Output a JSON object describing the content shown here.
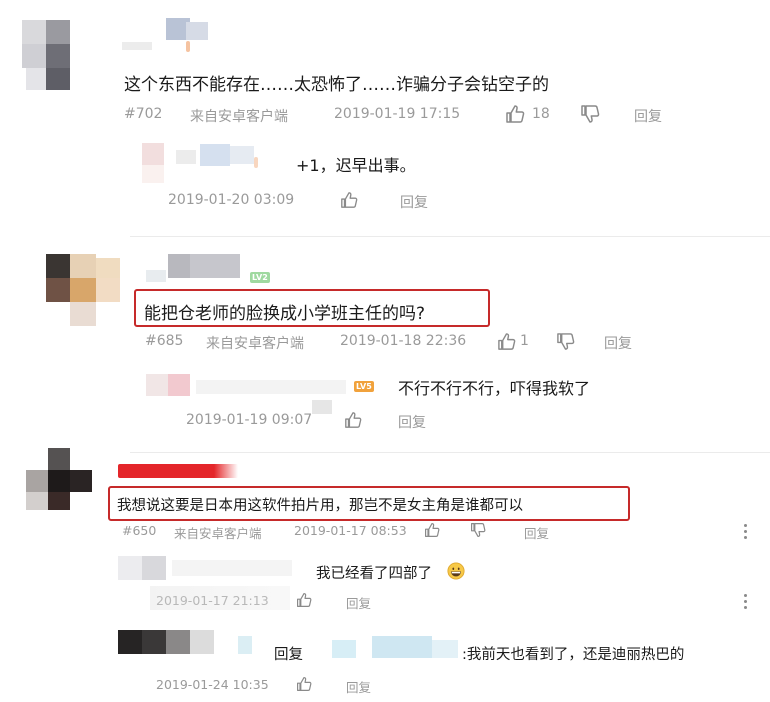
{
  "comments": [
    {
      "text": "这个东西不能存在……太恐怖了……诈骗分子会钻空子的",
      "floor": "#702",
      "source": "来自安卓客户端",
      "time": "2019-01-19 17:15",
      "likes": "18",
      "reply_label": "回复",
      "sub_replies": [
        {
          "text": "+1，迟早出事。",
          "time": "2019-01-20 03:09",
          "reply_label": "回复"
        }
      ]
    },
    {
      "level_badge": "LV2",
      "text": "能把仓老师的脸换成小学班主任的吗?",
      "floor": "#685",
      "source": "来自安卓客户端",
      "time": "2019-01-18 22:36",
      "likes": "1",
      "reply_label": "回复",
      "sub_replies": [
        {
          "level_badge": "LV5",
          "text": "不行不行不行，吓得我软了",
          "time": "2019-01-19 09:07",
          "reply_label": "回复"
        }
      ]
    },
    {
      "text": "我想说这要是日本用这软件拍片用，那岂不是女主角是谁都可以",
      "floor": "#650",
      "source": "来自安卓客户端",
      "time": "2019-01-17 08:53",
      "reply_label": "回复",
      "sub_replies": [
        {
          "text": "我已经看了四部了",
          "emoji": "grinning-face-icon",
          "time": "2019-01-17 21:13",
          "reply_label": "回复"
        },
        {
          "reply_prefix": "回复",
          "text": ":我前天也看到了，还是迪丽热巴的",
          "time": "2019-01-24 10:35",
          "reply_label": "回复"
        }
      ]
    }
  ],
  "colors": {
    "highlight": "#c62a2a",
    "meta": "#9a9a9a",
    "text": "#1a1a1a"
  }
}
